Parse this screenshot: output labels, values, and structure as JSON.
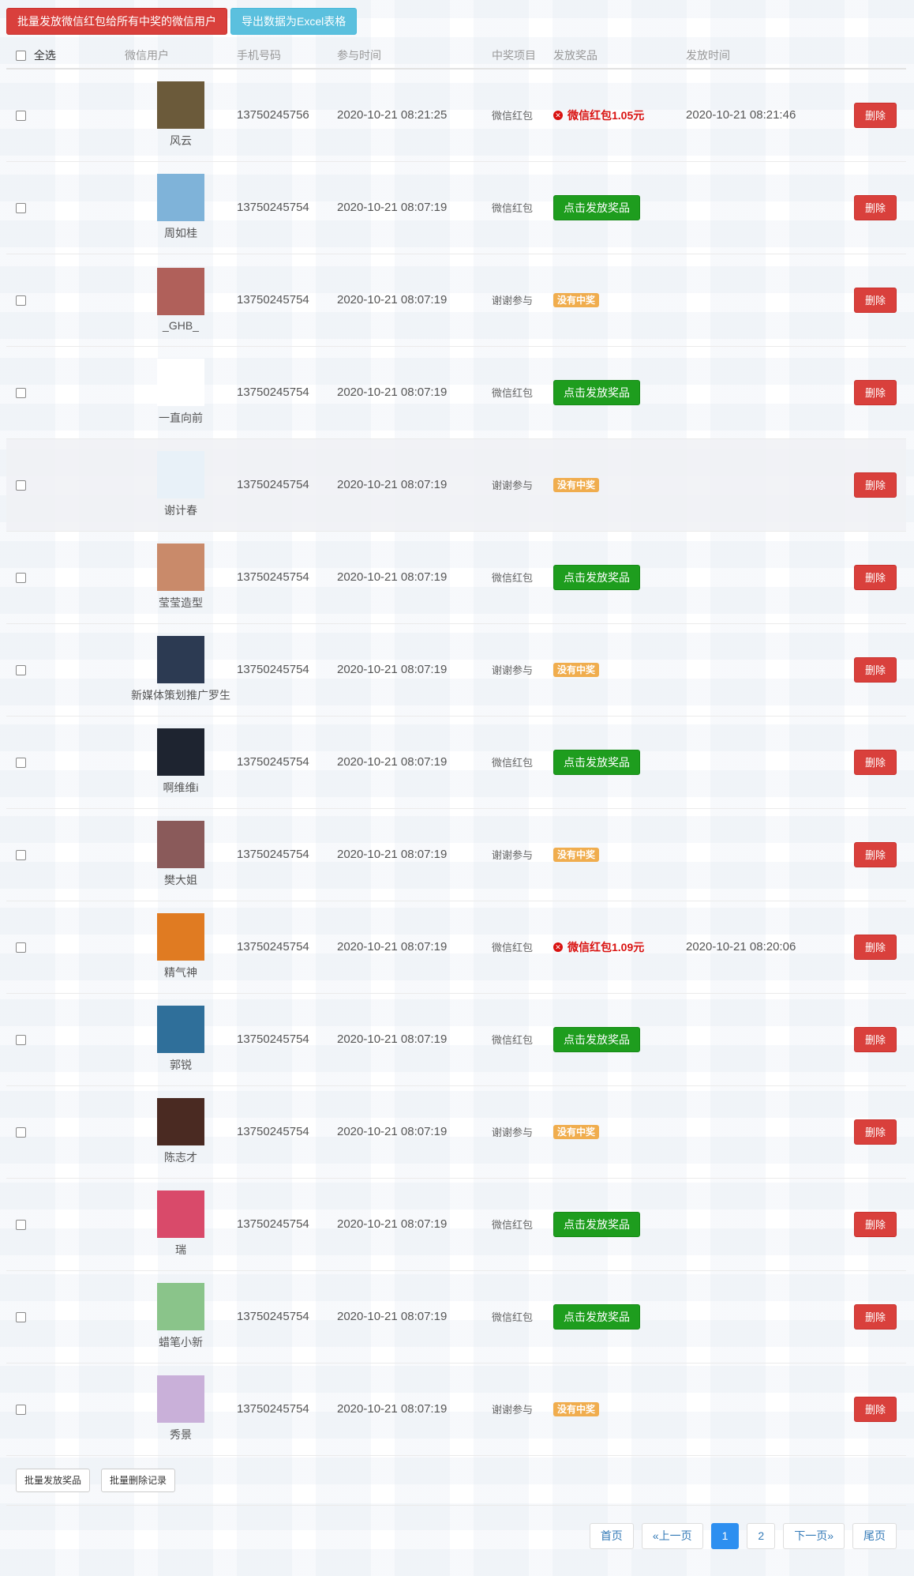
{
  "toolbar": {
    "batch_send_label": "批量发放微信红包给所有中奖的微信用户",
    "export_label": "导出数据为Excel表格"
  },
  "table": {
    "headers": {
      "select_all": "全选",
      "user": "微信用户",
      "phone": "手机号码",
      "join_time": "参与时间",
      "item": "中奖项目",
      "prize": "发放奖品",
      "send_time": "发放时间"
    },
    "labels": {
      "send_prize": "点击发放奖品",
      "no_prize": "没有中奖",
      "delete": "删除"
    },
    "rows": [
      {
        "name": "风云",
        "phone": "13750245756",
        "time": "2020-10-21 08:21:25",
        "item": "微信红包",
        "status": "won",
        "prize": "微信红包1.05元",
        "send_time": "2020-10-21 08:21:46",
        "avatar_color": "#6b5a3a"
      },
      {
        "name": "周如桂",
        "phone": "13750245754",
        "time": "2020-10-21 08:07:19",
        "item": "微信红包",
        "status": "send",
        "prize": "",
        "send_time": "",
        "avatar_color": "#7fb3d9"
      },
      {
        "name": "_GHB_",
        "phone": "13750245754",
        "time": "2020-10-21 08:07:19",
        "item": "谢谢参与",
        "status": "none",
        "prize": "",
        "send_time": "",
        "avatar_color": "#b0605a"
      },
      {
        "name": "一直向前",
        "phone": "13750245754",
        "time": "2020-10-21 08:07:19",
        "item": "微信红包",
        "status": "send",
        "prize": "",
        "send_time": "",
        "avatar_color": "#ffffff"
      },
      {
        "name": "谢计春",
        "phone": "13750245754",
        "time": "2020-10-21 08:07:19",
        "item": "谢谢参与",
        "status": "none",
        "prize": "",
        "send_time": "",
        "avatar_color": "#e8f1f8"
      },
      {
        "name": "莹莹造型",
        "phone": "13750245754",
        "time": "2020-10-21 08:07:19",
        "item": "微信红包",
        "status": "send",
        "prize": "",
        "send_time": "",
        "avatar_color": "#c98a6a"
      },
      {
        "name": "新媒体策划推广罗生",
        "phone": "13750245754",
        "time": "2020-10-21 08:07:19",
        "item": "谢谢参与",
        "status": "none",
        "prize": "",
        "send_time": "",
        "avatar_color": "#2c3a52"
      },
      {
        "name": "啊维维i",
        "phone": "13750245754",
        "time": "2020-10-21 08:07:19",
        "item": "微信红包",
        "status": "send",
        "prize": "",
        "send_time": "",
        "avatar_color": "#1e2430"
      },
      {
        "name": "樊大姐",
        "phone": "13750245754",
        "time": "2020-10-21 08:07:19",
        "item": "谢谢参与",
        "status": "none",
        "prize": "",
        "send_time": "",
        "avatar_color": "#8a5a5a"
      },
      {
        "name": "精气神",
        "phone": "13750245754",
        "time": "2020-10-21 08:07:19",
        "item": "微信红包",
        "status": "won",
        "prize": "微信红包1.09元",
        "send_time": "2020-10-21 08:20:06",
        "avatar_color": "#e07b22"
      },
      {
        "name": "郭锐",
        "phone": "13750245754",
        "time": "2020-10-21 08:07:19",
        "item": "微信红包",
        "status": "send",
        "prize": "",
        "send_time": "",
        "avatar_color": "#2f6f9a"
      },
      {
        "name": "陈志才",
        "phone": "13750245754",
        "time": "2020-10-21 08:07:19",
        "item": "谢谢参与",
        "status": "none",
        "prize": "",
        "send_time": "",
        "avatar_color": "#4a2a22"
      },
      {
        "name": "瑞",
        "phone": "13750245754",
        "time": "2020-10-21 08:07:19",
        "item": "微信红包",
        "status": "send",
        "prize": "",
        "send_time": "",
        "avatar_color": "#d94a6a"
      },
      {
        "name": "蜡笔小新",
        "phone": "13750245754",
        "time": "2020-10-21 08:07:19",
        "item": "微信红包",
        "status": "send",
        "prize": "",
        "send_time": "",
        "avatar_color": "#8ac48a"
      },
      {
        "name": "秀景",
        "phone": "13750245754",
        "time": "2020-10-21 08:07:19",
        "item": "谢谢参与",
        "status": "none",
        "prize": "",
        "send_time": "",
        "avatar_color": "#c9b0d9"
      }
    ]
  },
  "bottom": {
    "batch_prize_label": "批量发放奖品",
    "batch_delete_label": "批量删除记录"
  },
  "pagination": {
    "first": "首页",
    "prev": "«上一页",
    "pages": [
      "1",
      "2"
    ],
    "current": "1",
    "next": "下一页»",
    "last": "尾页"
  },
  "colors": {
    "danger": "#d9403c",
    "info": "#5bc0de",
    "success": "#1e9d1e",
    "warning": "#f0ad4e",
    "won_text": "#d9110f",
    "page_active": "#2d8ff0"
  }
}
